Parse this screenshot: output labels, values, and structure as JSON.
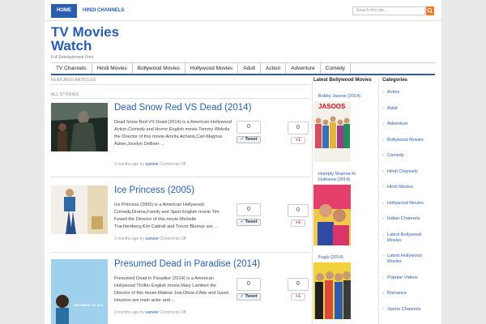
{
  "topnav": {
    "items": [
      {
        "label": "HOME"
      },
      {
        "label": "HINDI CHANNELS"
      }
    ]
  },
  "search": {
    "placeholder": "Search this site..."
  },
  "site": {
    "title": "TV Movies Watch",
    "tagline": "Full Entertainment Free"
  },
  "catnav": {
    "items": [
      "TV Channels",
      "Hindi Movies",
      "Bollywood Movies",
      "Hollywood Movies",
      "Adult",
      "Action",
      "Adventure",
      "Comedy"
    ]
  },
  "sections": {
    "featured": "FEATURED ARTICLES",
    "all": "ALL STORIES"
  },
  "posts": [
    {
      "title": "Dead Snow Red VS Dead (2014)",
      "excerpt": "Dead Snow Red VS Dead (2014) is a American Hollywood Action,Comedy and Horror English movie.Tommy Wirkola the Director of this movie.Amrita Acharia,Carl-Magnus Adner,Jocelyn DeBoer ...",
      "meta_prefix": "3 months ago by",
      "author": "sameer",
      "meta_suffix": "Comments Off",
      "tweet_count": "0",
      "tweet_label": "Tweet",
      "gplus_count": "0",
      "gplus_label": "+1"
    },
    {
      "title": "Ice Princess (2005)",
      "excerpt": "Ice Princess (2005) is a American Hollywood Comedy,Drama,Family and Sport English movie.Tim Fywell the Director of this movie.Michelle Trachtenberg,Kim Cattrall and Trevor Blumas are ...",
      "meta_prefix": "3 months ago by",
      "author": "sameer",
      "meta_suffix": "Comments Off",
      "tweet_count": "0",
      "tweet_label": "Tweet",
      "gplus_count": "0",
      "gplus_label": "+1"
    },
    {
      "title": "Presumed Dead in Paradise (2014)",
      "excerpt": "Presumed Dead in Paradise (2014) is a American Hollywood Thriller English movie.Mary Lambert the Director of this movie.Malese Jow,Olivia d'Abo and Gavin Houston are main actor and ...",
      "meta_prefix": "3 months ago by",
      "author": "sameer",
      "meta_suffix": "Comments Off",
      "tweet_count": "0",
      "tweet_label": "Tweet",
      "gplus_count": "0",
      "gplus_label": "+1"
    }
  ],
  "latest": {
    "heading": "Latest Bollywood Movies",
    "items": [
      {
        "title": "Bobby Jasoos (2014)",
        "poster_text": "JASOOS"
      },
      {
        "title": "Humpty Sharma Ki Dulhania (2014)"
      },
      {
        "title": "Fugly (2014)"
      }
    ]
  },
  "categories": {
    "heading": "Categories",
    "items": [
      "Action",
      "Adult",
      "Adventure",
      "Bollywood Movies",
      "Comedy",
      "Hindi Channels",
      "Hindi Movies",
      "Hollywood Movies",
      "Indian Channels",
      "Latest Bollywood Movies",
      "Latest Hollywood Movies",
      "Popular Videos",
      "Romance",
      "Sports Channels"
    ]
  },
  "thumbs": {
    "post3_text": "SATURDAY AT 8/7c"
  },
  "colors": {
    "accent": "#2a5db0",
    "search_button": "#f07a2a",
    "gplus": "#d73d32"
  }
}
